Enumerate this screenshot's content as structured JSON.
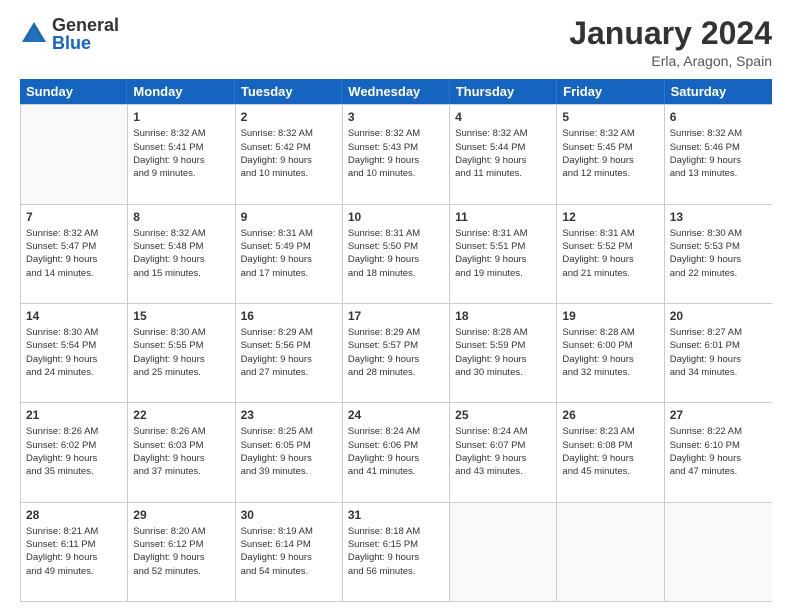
{
  "logo": {
    "general": "General",
    "blue": "Blue",
    "icon_color": "#1a6baf"
  },
  "header": {
    "month": "January 2024",
    "location": "Erla, Aragon, Spain"
  },
  "weekdays": [
    "Sunday",
    "Monday",
    "Tuesday",
    "Wednesday",
    "Thursday",
    "Friday",
    "Saturday"
  ],
  "rows": [
    [
      {
        "day": "",
        "text": ""
      },
      {
        "day": "1",
        "text": "Sunrise: 8:32 AM\nSunset: 5:41 PM\nDaylight: 9 hours\nand 9 minutes."
      },
      {
        "day": "2",
        "text": "Sunrise: 8:32 AM\nSunset: 5:42 PM\nDaylight: 9 hours\nand 10 minutes."
      },
      {
        "day": "3",
        "text": "Sunrise: 8:32 AM\nSunset: 5:43 PM\nDaylight: 9 hours\nand 10 minutes."
      },
      {
        "day": "4",
        "text": "Sunrise: 8:32 AM\nSunset: 5:44 PM\nDaylight: 9 hours\nand 11 minutes."
      },
      {
        "day": "5",
        "text": "Sunrise: 8:32 AM\nSunset: 5:45 PM\nDaylight: 9 hours\nand 12 minutes."
      },
      {
        "day": "6",
        "text": "Sunrise: 8:32 AM\nSunset: 5:46 PM\nDaylight: 9 hours\nand 13 minutes."
      }
    ],
    [
      {
        "day": "7",
        "text": "Sunrise: 8:32 AM\nSunset: 5:47 PM\nDaylight: 9 hours\nand 14 minutes."
      },
      {
        "day": "8",
        "text": "Sunrise: 8:32 AM\nSunset: 5:48 PM\nDaylight: 9 hours\nand 15 minutes."
      },
      {
        "day": "9",
        "text": "Sunrise: 8:31 AM\nSunset: 5:49 PM\nDaylight: 9 hours\nand 17 minutes."
      },
      {
        "day": "10",
        "text": "Sunrise: 8:31 AM\nSunset: 5:50 PM\nDaylight: 9 hours\nand 18 minutes."
      },
      {
        "day": "11",
        "text": "Sunrise: 8:31 AM\nSunset: 5:51 PM\nDaylight: 9 hours\nand 19 minutes."
      },
      {
        "day": "12",
        "text": "Sunrise: 8:31 AM\nSunset: 5:52 PM\nDaylight: 9 hours\nand 21 minutes."
      },
      {
        "day": "13",
        "text": "Sunrise: 8:30 AM\nSunset: 5:53 PM\nDaylight: 9 hours\nand 22 minutes."
      }
    ],
    [
      {
        "day": "14",
        "text": "Sunrise: 8:30 AM\nSunset: 5:54 PM\nDaylight: 9 hours\nand 24 minutes."
      },
      {
        "day": "15",
        "text": "Sunrise: 8:30 AM\nSunset: 5:55 PM\nDaylight: 9 hours\nand 25 minutes."
      },
      {
        "day": "16",
        "text": "Sunrise: 8:29 AM\nSunset: 5:56 PM\nDaylight: 9 hours\nand 27 minutes."
      },
      {
        "day": "17",
        "text": "Sunrise: 8:29 AM\nSunset: 5:57 PM\nDaylight: 9 hours\nand 28 minutes."
      },
      {
        "day": "18",
        "text": "Sunrise: 8:28 AM\nSunset: 5:59 PM\nDaylight: 9 hours\nand 30 minutes."
      },
      {
        "day": "19",
        "text": "Sunrise: 8:28 AM\nSunset: 6:00 PM\nDaylight: 9 hours\nand 32 minutes."
      },
      {
        "day": "20",
        "text": "Sunrise: 8:27 AM\nSunset: 6:01 PM\nDaylight: 9 hours\nand 34 minutes."
      }
    ],
    [
      {
        "day": "21",
        "text": "Sunrise: 8:26 AM\nSunset: 6:02 PM\nDaylight: 9 hours\nand 35 minutes."
      },
      {
        "day": "22",
        "text": "Sunrise: 8:26 AM\nSunset: 6:03 PM\nDaylight: 9 hours\nand 37 minutes."
      },
      {
        "day": "23",
        "text": "Sunrise: 8:25 AM\nSunset: 6:05 PM\nDaylight: 9 hours\nand 39 minutes."
      },
      {
        "day": "24",
        "text": "Sunrise: 8:24 AM\nSunset: 6:06 PM\nDaylight: 9 hours\nand 41 minutes."
      },
      {
        "day": "25",
        "text": "Sunrise: 8:24 AM\nSunset: 6:07 PM\nDaylight: 9 hours\nand 43 minutes."
      },
      {
        "day": "26",
        "text": "Sunrise: 8:23 AM\nSunset: 6:08 PM\nDaylight: 9 hours\nand 45 minutes."
      },
      {
        "day": "27",
        "text": "Sunrise: 8:22 AM\nSunset: 6:10 PM\nDaylight: 9 hours\nand 47 minutes."
      }
    ],
    [
      {
        "day": "28",
        "text": "Sunrise: 8:21 AM\nSunset: 6:11 PM\nDaylight: 9 hours\nand 49 minutes."
      },
      {
        "day": "29",
        "text": "Sunrise: 8:20 AM\nSunset: 6:12 PM\nDaylight: 9 hours\nand 52 minutes."
      },
      {
        "day": "30",
        "text": "Sunrise: 8:19 AM\nSunset: 6:14 PM\nDaylight: 9 hours\nand 54 minutes."
      },
      {
        "day": "31",
        "text": "Sunrise: 8:18 AM\nSunset: 6:15 PM\nDaylight: 9 hours\nand 56 minutes."
      },
      {
        "day": "",
        "text": ""
      },
      {
        "day": "",
        "text": ""
      },
      {
        "day": "",
        "text": ""
      }
    ]
  ]
}
